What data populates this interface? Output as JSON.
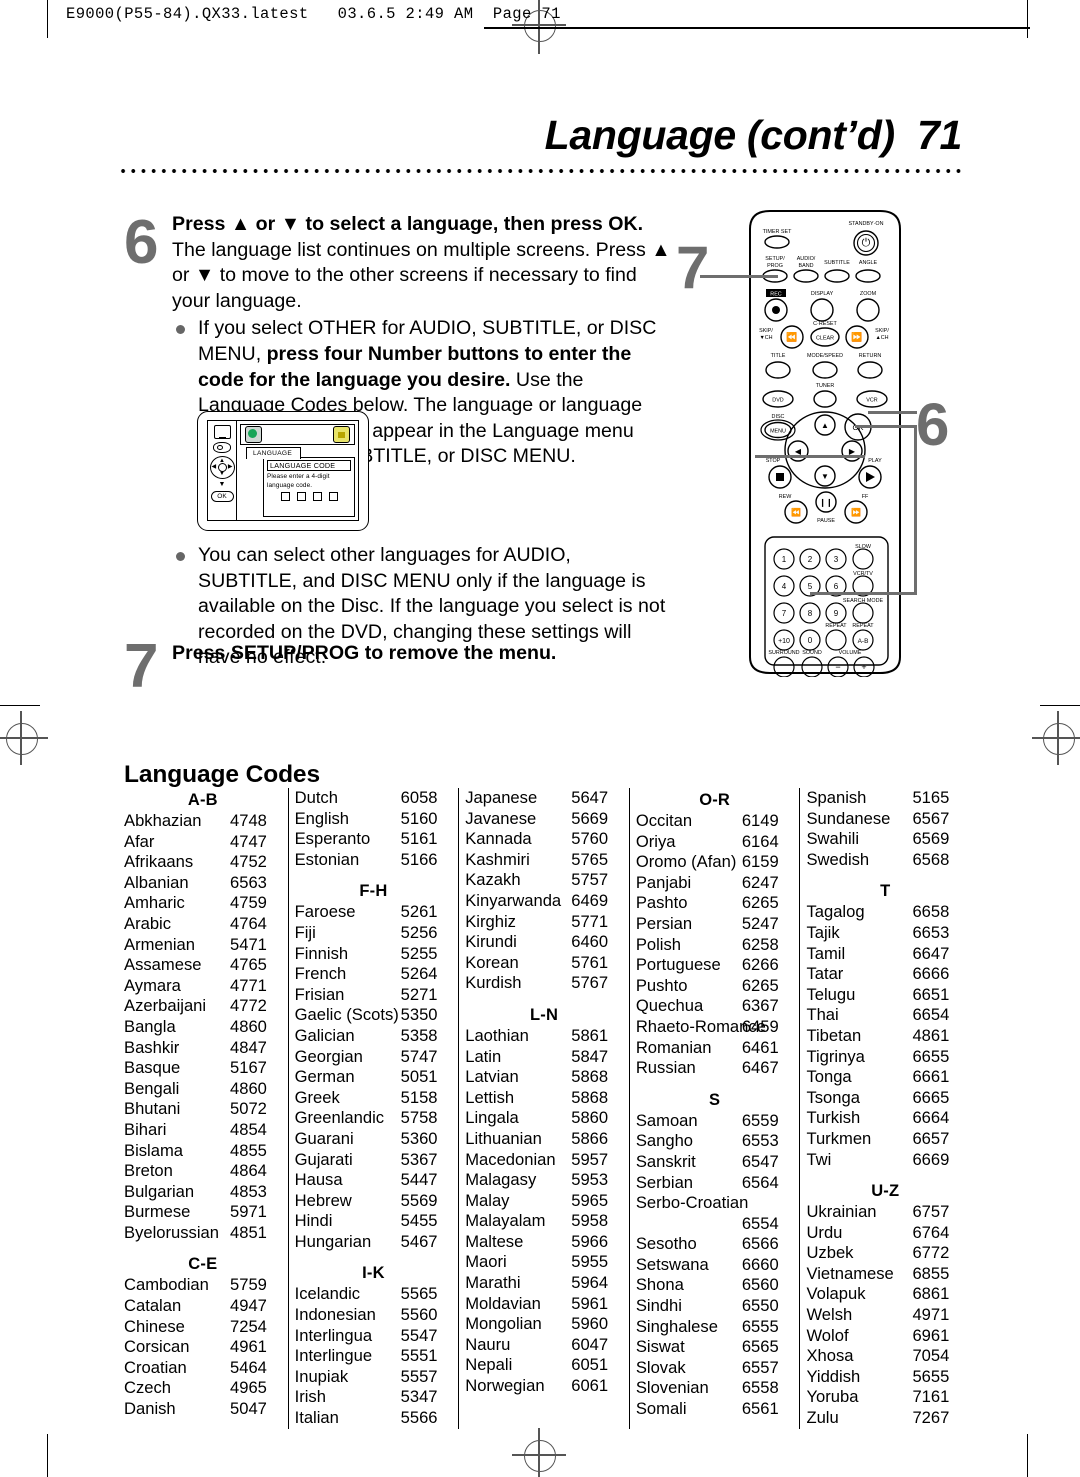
{
  "slug": "E9000(P55-84).QX33.latest   03.6.5 2:49 AM  Page 71",
  "page_title": "Language (cont’d)  71",
  "steps": [
    {
      "number": "6",
      "paragraphs": [
        {
          "type": "body",
          "runs": [
            {
              "bold": true,
              "text": "Press ▲ or ▼ to select a language, then press OK."
            },
            {
              "bold": false,
              "text": " The language list continues on multiple screens. Press ▲ or ▼ to move to the other screens if necessary to find your language."
            }
          ]
        },
        {
          "type": "bullet",
          "runs": [
            {
              "bold": false,
              "text": "If you select OTHER for AUDIO, SUBTITLE, or DISC MENU, "
            },
            {
              "bold": true,
              "text": "press four Number buttons to enter the code for the language you desire."
            },
            {
              "bold": false,
              "text": " Use the Language Codes below. The language or language code you select will appear in the Language menu beside AUDIO, SUBTITLE, or DISC MENU."
            }
          ]
        },
        {
          "type": "bullet",
          "runs": [
            {
              "bold": false,
              "text": "You can select other languages for AUDIO, SUBTITLE, and DISC MENU only if the language is available on the Disc. If the language you select is not recorded on the DVD, changing these settings will have no effect."
            }
          ]
        }
      ]
    },
    {
      "number": "7",
      "paragraphs": [
        {
          "type": "body",
          "runs": [
            {
              "bold": true,
              "text": "Press SETUP/PROG to remove the menu."
            }
          ]
        }
      ]
    }
  ],
  "callouts": {
    "step7": "7",
    "step6": "6"
  },
  "tv_screen": {
    "tab_label": "LANGUAGE",
    "highlight_bar": "LANGUAGE CODE",
    "hint": "Please enter a 4-digit language code.",
    "digit_boxes": 4,
    "side_icons": [
      "monitor-icon",
      "disc-icon",
      "dpad-icon",
      "down-arrow-icon",
      "ok-button"
    ],
    "top_icons": [
      "globe-icon",
      "lock-icon"
    ],
    "ok_label": "OK"
  },
  "remote": {
    "labels": {
      "timer_set": "TIMER SET",
      "standby_on": "STANDBY·ON",
      "setup_prog": "SETUP/\nPROG",
      "audio_band": "AUDIO/\nBAND",
      "subtitle": "SUBTITLE",
      "angle": "ANGLE",
      "rec": "REC",
      "display": "DISPLAY",
      "zoom": "ZOOM",
      "skip_down": "SKIP/\n▼CH",
      "c_reset": "C·RESET",
      "clear": "CLEAR",
      "skip_up": "SKIP/\n▲CH",
      "title": "TITLE",
      "mode_speed": "MODE/SPEED",
      "return": "RETURN",
      "dvd": "DVD",
      "tuner": "TUNER",
      "vcr": "VCR",
      "disc": "DISC",
      "menu": "MENU",
      "ok": "OK",
      "stop": "STOP",
      "play": "PLAY",
      "rew": "REW",
      "pause": "PAUSE",
      "ff": "FF",
      "slow": "SLOW",
      "vcr_tv": "VCR/TV",
      "search_mode": "SEARCH MODE",
      "repeat": "REPEAT",
      "repeat_ab": "REPEAT",
      "ab": "A-B",
      "surround": "SURROUND",
      "sound": "SOUND",
      "volume": "VOLUME",
      "plus10": "+10"
    },
    "number_keys": [
      "1",
      "2",
      "3",
      "4",
      "5",
      "6",
      "7",
      "8",
      "9",
      "+10",
      "0"
    ]
  },
  "language_codes": {
    "title": "Language Codes",
    "columns": [
      {
        "sections": [
          {
            "head": "A-B",
            "entries": [
              {
                "name": "Abkhazian",
                "code": "4748"
              },
              {
                "name": "Afar",
                "code": "4747"
              },
              {
                "name": "Afrikaans",
                "code": "4752"
              },
              {
                "name": "Albanian",
                "code": "6563"
              },
              {
                "name": "Amharic",
                "code": "4759"
              },
              {
                "name": "Arabic",
                "code": "4764"
              },
              {
                "name": "Armenian",
                "code": "5471"
              },
              {
                "name": "Assamese",
                "code": "4765"
              },
              {
                "name": "Aymara",
                "code": "4771"
              },
              {
                "name": "Azerbaijani",
                "code": "4772"
              },
              {
                "name": "Bangla",
                "code": "4860"
              },
              {
                "name": "Bashkir",
                "code": "4847"
              },
              {
                "name": "Basque",
                "code": "5167"
              },
              {
                "name": "Bengali",
                "code": "4860"
              },
              {
                "name": "Bhutani",
                "code": "5072"
              },
              {
                "name": "Bihari",
                "code": "4854"
              },
              {
                "name": "Bislama",
                "code": "4855"
              },
              {
                "name": "Breton",
                "code": "4864"
              },
              {
                "name": "Bulgarian",
                "code": "4853"
              },
              {
                "name": "Burmese",
                "code": "5971"
              },
              {
                "name": "Byelorussian",
                "code": "4851"
              }
            ]
          },
          {
            "head": "C-E",
            "entries": [
              {
                "name": "Cambodian",
                "code": "5759"
              },
              {
                "name": "Catalan",
                "code": "4947"
              },
              {
                "name": "Chinese",
                "code": "7254"
              },
              {
                "name": "Corsican",
                "code": "4961"
              },
              {
                "name": "Croatian",
                "code": "5464"
              },
              {
                "name": "Czech",
                "code": "4965"
              },
              {
                "name": "Danish",
                "code": "5047"
              }
            ]
          }
        ]
      },
      {
        "sections": [
          {
            "head": "",
            "entries": [
              {
                "name": "Dutch",
                "code": "6058"
              },
              {
                "name": "English",
                "code": "5160"
              },
              {
                "name": "Esperanto",
                "code": "5161"
              },
              {
                "name": "Estonian",
                "code": "5166"
              }
            ]
          },
          {
            "head": "F-H",
            "entries": [
              {
                "name": "Faroese",
                "code": "5261"
              },
              {
                "name": "Fiji",
                "code": "5256"
              },
              {
                "name": "Finnish",
                "code": "5255"
              },
              {
                "name": "French",
                "code": "5264"
              },
              {
                "name": "Frisian",
                "code": "5271"
              },
              {
                "name": "Gaelic (Scots)",
                "code": "5350"
              },
              {
                "name": "Galician",
                "code": "5358"
              },
              {
                "name": "Georgian",
                "code": "5747"
              },
              {
                "name": "German",
                "code": "5051"
              },
              {
                "name": "Greek",
                "code": "5158"
              },
              {
                "name": "Greenlandic",
                "code": "5758"
              },
              {
                "name": "Guarani",
                "code": "5360"
              },
              {
                "name": "Gujarati",
                "code": "5367"
              },
              {
                "name": "Hausa",
                "code": "5447"
              },
              {
                "name": "Hebrew",
                "code": "5569"
              },
              {
                "name": "Hindi",
                "code": "5455"
              },
              {
                "name": "Hungarian",
                "code": "5467"
              }
            ]
          },
          {
            "head": "I-K",
            "entries": [
              {
                "name": "Icelandic",
                "code": "5565"
              },
              {
                "name": "Indonesian",
                "code": "5560"
              },
              {
                "name": "Interlingua",
                "code": "5547"
              },
              {
                "name": "Interlingue",
                "code": "5551"
              },
              {
                "name": "Inupiak",
                "code": "5557"
              },
              {
                "name": "Irish",
                "code": "5347"
              },
              {
                "name": "Italian",
                "code": "5566"
              }
            ]
          }
        ]
      },
      {
        "sections": [
          {
            "head": "",
            "entries": [
              {
                "name": "Japanese",
                "code": "5647"
              },
              {
                "name": "Javanese",
                "code": "5669"
              },
              {
                "name": "Kannada",
                "code": "5760"
              },
              {
                "name": "Kashmiri",
                "code": "5765"
              },
              {
                "name": "Kazakh",
                "code": "5757"
              },
              {
                "name": "Kinyarwanda",
                "code": "6469"
              },
              {
                "name": "Kirghiz",
                "code": "5771"
              },
              {
                "name": "Kirundi",
                "code": "6460"
              },
              {
                "name": "Korean",
                "code": "5761"
              },
              {
                "name": "Kurdish",
                "code": "5767"
              }
            ]
          },
          {
            "head": "L-N",
            "entries": [
              {
                "name": "Laothian",
                "code": "5861"
              },
              {
                "name": "Latin",
                "code": "5847"
              },
              {
                "name": "Latvian",
                "code": "5868"
              },
              {
                "name": "Lettish",
                "code": "5868"
              },
              {
                "name": "Lingala",
                "code": "5860"
              },
              {
                "name": "Lithuanian",
                "code": "5866"
              },
              {
                "name": "Macedonian",
                "code": "5957"
              },
              {
                "name": "Malagasy",
                "code": "5953"
              },
              {
                "name": "Malay",
                "code": "5965"
              },
              {
                "name": "Malayalam",
                "code": "5958"
              },
              {
                "name": "Maltese",
                "code": "5966"
              },
              {
                "name": "Maori",
                "code": "5955"
              },
              {
                "name": "Marathi",
                "code": "5964"
              },
              {
                "name": "Moldavian",
                "code": "5961"
              },
              {
                "name": "Mongolian",
                "code": "5960"
              },
              {
                "name": "Nauru",
                "code": "6047"
              },
              {
                "name": "Nepali",
                "code": "6051"
              },
              {
                "name": "Norwegian",
                "code": "6061"
              }
            ]
          }
        ]
      },
      {
        "sections": [
          {
            "head": "O-R",
            "entries": [
              {
                "name": "Occitan",
                "code": "6149"
              },
              {
                "name": "Oriya",
                "code": "6164"
              },
              {
                "name": "Oromo (Afan)",
                "code": "6159"
              },
              {
                "name": "Panjabi",
                "code": "6247"
              },
              {
                "name": "Pashto",
                "code": "6265"
              },
              {
                "name": "Persian",
                "code": "5247"
              },
              {
                "name": "Polish",
                "code": "6258"
              },
              {
                "name": "Portuguese",
                "code": "6266"
              },
              {
                "name": "Pushto",
                "code": "6265"
              },
              {
                "name": "Quechua",
                "code": "6367"
              },
              {
                "name": "Rhaeto-Romance",
                "code": "6459"
              },
              {
                "name": "Romanian",
                "code": "6461"
              },
              {
                "name": "Russian",
                "code": "6467"
              }
            ]
          },
          {
            "head": "S",
            "entries": [
              {
                "name": "Samoan",
                "code": "6559"
              },
              {
                "name": "Sangho",
                "code": "6553"
              },
              {
                "name": "Sanskrit",
                "code": "6547"
              },
              {
                "name": "Serbian",
                "code": "6564"
              },
              {
                "name": "Serbo-Croatian",
                "code": ""
              },
              {
                "name": "",
                "code": "6554"
              },
              {
                "name": "Sesotho",
                "code": "6566"
              },
              {
                "name": "Setswana",
                "code": "6660"
              },
              {
                "name": "Shona",
                "code": "6560"
              },
              {
                "name": "Sindhi",
                "code": "6550"
              },
              {
                "name": "Singhalese",
                "code": "6555"
              },
              {
                "name": "Siswat",
                "code": "6565"
              },
              {
                "name": "Slovak",
                "code": "6557"
              },
              {
                "name": "Slovenian",
                "code": "6558"
              },
              {
                "name": "Somali",
                "code": "6561"
              }
            ]
          }
        ]
      },
      {
        "sections": [
          {
            "head": "",
            "entries": [
              {
                "name": "Spanish",
                "code": "5165"
              },
              {
                "name": "Sundanese",
                "code": "6567"
              },
              {
                "name": "Swahili",
                "code": "6569"
              },
              {
                "name": "Swedish",
                "code": "6568"
              }
            ]
          },
          {
            "head": "T",
            "entries": [
              {
                "name": "Tagalog",
                "code": "6658"
              },
              {
                "name": "Tajik",
                "code": "6653"
              },
              {
                "name": "Tamil",
                "code": "6647"
              },
              {
                "name": "Tatar",
                "code": "6666"
              },
              {
                "name": "Telugu",
                "code": "6651"
              },
              {
                "name": "Thai",
                "code": "6654"
              },
              {
                "name": "Tibetan",
                "code": "4861"
              },
              {
                "name": "Tigrinya",
                "code": "6655"
              },
              {
                "name": "Tonga",
                "code": "6661"
              },
              {
                "name": "Tsonga",
                "code": "6665"
              },
              {
                "name": "Turkish",
                "code": "6664"
              },
              {
                "name": "Turkmen",
                "code": "6657"
              },
              {
                "name": "Twi",
                "code": "6669"
              }
            ]
          },
          {
            "head": "U-Z",
            "entries": [
              {
                "name": "Ukrainian",
                "code": "6757"
              },
              {
                "name": "Urdu",
                "code": "6764"
              },
              {
                "name": "Uzbek",
                "code": "6772"
              },
              {
                "name": "Vietnamese",
                "code": "6855"
              },
              {
                "name": "Volapuk",
                "code": "6861"
              },
              {
                "name": "Welsh",
                "code": "4971"
              },
              {
                "name": "Wolof",
                "code": "6961"
              },
              {
                "name": "Xhosa",
                "code": "7054"
              },
              {
                "name": "Yiddish",
                "code": "5655"
              },
              {
                "name": "Yoruba",
                "code": "7161"
              },
              {
                "name": "Zulu",
                "code": "7267"
              }
            ]
          }
        ]
      }
    ]
  }
}
